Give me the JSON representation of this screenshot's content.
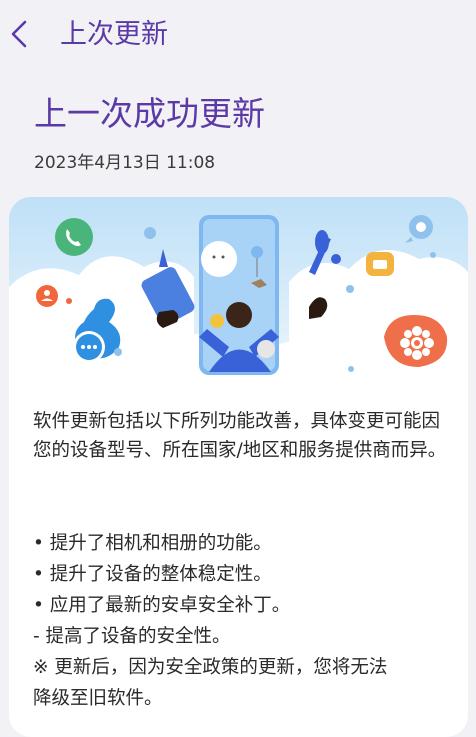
{
  "header": {
    "title": "上次更新",
    "back_icon": "chevron-left-icon"
  },
  "main": {
    "heading": "上一次成功更新",
    "date": "2023年4月13日 11:08"
  },
  "card": {
    "description": "软件更新包括以下所列功能改善，具体变更可能因您的设备型号、所在国家/地区和服务提供商而异。",
    "items": [
      "• 提升了相机和相册的功能。",
      "• 提升了设备的整体稳定性。",
      "• 应用了最新的安卓安全补丁。",
      " - 提高了设备的安全性。",
      "※ 更新后，因为安全政策的更新，您将无法",
      "降级至旧软件。"
    ]
  },
  "colors": {
    "accent": "#5b3aa8",
    "background": "#f2f1f5",
    "card": "#ffffff"
  }
}
